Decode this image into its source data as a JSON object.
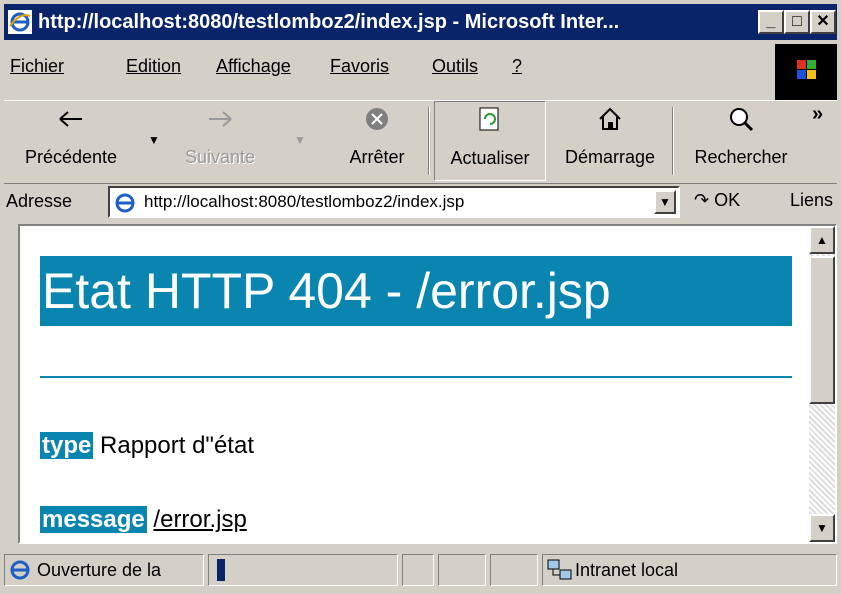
{
  "window": {
    "title": "http://localhost:8080/testlomboz2/index.jsp - Microsoft Inter...",
    "min": "_",
    "max": "□",
    "close": "✕"
  },
  "menu": [
    "Fichier",
    "Edition",
    "Affichage",
    "Favoris",
    "Outils",
    "?"
  ],
  "toolbar": {
    "back": "Précédente",
    "forward": "Suivante",
    "stop": "Arrêter",
    "refresh": "Actualiser",
    "home": "Démarrage",
    "search": "Rechercher",
    "more": "»"
  },
  "address": {
    "label": "Adresse",
    "url": "http://localhost:8080/testlomboz2/index.jsp",
    "go": "OK",
    "links": "Liens"
  },
  "content": {
    "heading": "Etat HTTP 404 - /error.jsp",
    "type_label": "type",
    "type_value": "Rapport d\"état",
    "message_label": "message",
    "message_value": "/error.jsp"
  },
  "status": {
    "text": "Ouverture de la",
    "zone": "Intranet local"
  },
  "colors": {
    "titlebar": "#0a246a",
    "accent": "#0a85b0",
    "chrome": "#d4d0c8"
  }
}
